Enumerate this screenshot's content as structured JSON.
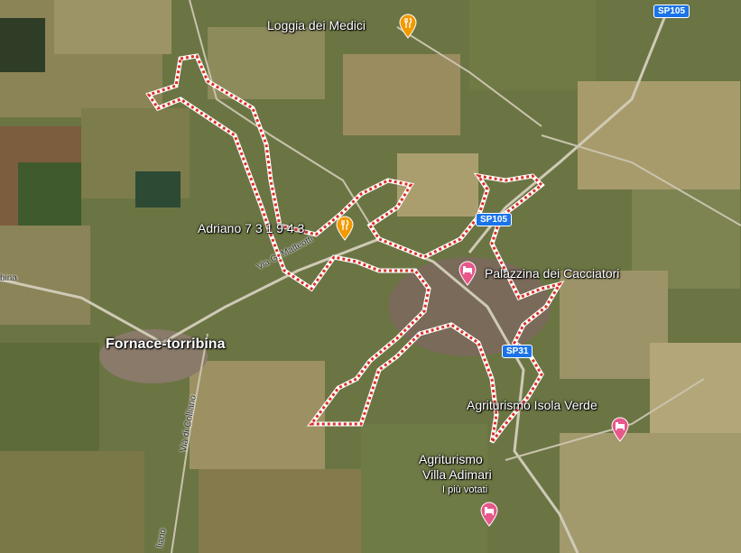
{
  "map": {
    "pois": [
      {
        "name": "Loggia dei Medici",
        "type": "restaurant"
      },
      {
        "name": "Adriano 7 3 1 9 4 3",
        "type": "restaurant"
      },
      {
        "name": "Palazzina dei Cacciatori",
        "type": "lodging"
      },
      {
        "name": "Agriturismo Isola Verde",
        "type": "lodging"
      },
      {
        "name": "Agriturismo",
        "type": "lodging"
      },
      {
        "name": "Villa Adimari",
        "type": "lodging"
      }
    ],
    "poi_badge": "I più votati",
    "town": "Fornace-torribina",
    "road_shields": [
      "SP105",
      "SP105",
      "SP31"
    ],
    "road_labels": [
      "Via G. Matteotti",
      "Via di Colliano",
      "bina",
      "liano"
    ],
    "icons": {
      "restaurant": "restaurant-icon",
      "lodging": "hotel-icon"
    },
    "colors": {
      "restaurant_pin": "#f29900",
      "lodging_pin": "#e8578a",
      "boundary_outer": "#ffffff",
      "boundary_dash": "#d93025",
      "shield": "#1a73e8"
    }
  }
}
